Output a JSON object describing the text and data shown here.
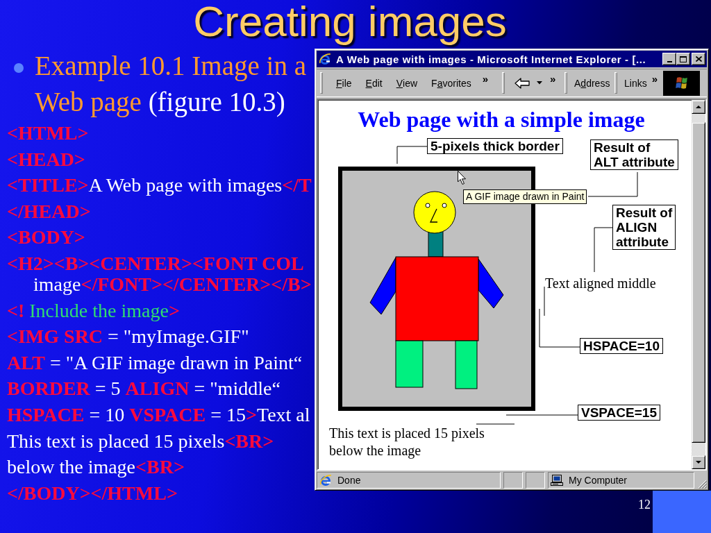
{
  "slide": {
    "title": "Creating images",
    "bullet": {
      "lines": [
        [
          {
            "kind": "accent",
            "text": "Example 10.1 Image in a"
          }
        ],
        [
          {
            "kind": "accent",
            "text": "Web page"
          },
          {
            "kind": "plain",
            "text": " (figure 10.3)"
          }
        ]
      ]
    },
    "code_lines": [
      {
        "segments": [
          {
            "kind": "tag",
            "text": "<HTML>"
          }
        ]
      },
      {
        "segments": [
          {
            "kind": "tag",
            "text": "<HEAD>"
          }
        ]
      },
      {
        "segments": [
          {
            "kind": "tag",
            "text": "<TITLE>"
          },
          {
            "kind": "text",
            "text": "A Web page with images"
          },
          {
            "kind": "tag",
            "text": "</T"
          }
        ]
      },
      {
        "segments": [
          {
            "kind": "tag",
            "text": "</HEAD>"
          }
        ]
      },
      {
        "segments": [
          {
            "kind": "tag",
            "text": "<BODY>"
          }
        ]
      },
      {
        "segments": [
          {
            "kind": "tag",
            "text": "<H2><B><CENTER><FONT COL"
          }
        ],
        "wrapped_segments": [
          {
            "kind": "text",
            "text": "image"
          },
          {
            "kind": "tag",
            "text": "</FONT></CENTER></B>"
          }
        ]
      },
      {
        "segments": [
          {
            "kind": "tag",
            "text": "<!"
          },
          {
            "kind": "comment",
            "text": " Include the image"
          },
          {
            "kind": "tag",
            "text": ">"
          }
        ]
      },
      {
        "segments": [
          {
            "kind": "tag",
            "text": "<IMG SRC"
          },
          {
            "kind": "text",
            "text": " = \"myImage.GIF\""
          }
        ]
      },
      {
        "segments": [
          {
            "kind": "tag",
            "text": "ALT"
          },
          {
            "kind": "text",
            "text": " = \"A GIF image drawn in Paint“"
          }
        ]
      },
      {
        "segments": [
          {
            "kind": "tag",
            "text": "BORDER"
          },
          {
            "kind": "text",
            "text": " = 5 "
          },
          {
            "kind": "tag",
            "text": "ALIGN"
          },
          {
            "kind": "text",
            "text": " = \"middle“"
          }
        ]
      },
      {
        "segments": [
          {
            "kind": "tag",
            "text": "HSPACE"
          },
          {
            "kind": "text",
            "text": " = 10 "
          },
          {
            "kind": "tag",
            "text": "VSPACE"
          },
          {
            "kind": "text",
            "text": " = 15"
          },
          {
            "kind": "tag",
            "text": ">"
          },
          {
            "kind": "text",
            "text": "Text al"
          }
        ]
      },
      {
        "segments": [
          {
            "kind": "text",
            "text": "This text is placed 15 pixels"
          },
          {
            "kind": "tag",
            "text": "<BR>"
          }
        ]
      },
      {
        "segments": [
          {
            "kind": "text",
            "text": "below the image"
          },
          {
            "kind": "tag",
            "text": "<BR>"
          }
        ]
      },
      {
        "segments": [
          {
            "kind": "tag",
            "text": "</BODY></HTML>"
          }
        ]
      }
    ],
    "slide_number": "12"
  },
  "browser": {
    "title": "A Web page with images - Microsoft Internet Explorer - [...",
    "menu": [
      {
        "key": "F",
        "after": "ile"
      },
      {
        "key": "E",
        "after": "dit"
      },
      {
        "key": "V",
        "after": "iew"
      },
      {
        "before": "F",
        "key": "a",
        "after": "vorites"
      }
    ],
    "toolbar": {
      "menu_chevron": "»",
      "nav_chevron": "»",
      "address": {
        "before": "A",
        "key": "d",
        "after": "dress"
      },
      "links": "Links",
      "links_chevron": "»"
    },
    "page": {
      "heading": "Web page with a simple image",
      "side_text": "Text aligned middle",
      "below_text": [
        "This text is placed 15 pixels",
        "below the image"
      ]
    },
    "callouts": [
      {
        "lines": [
          "5-pixels thick border"
        ]
      },
      {
        "lines": [
          "Result of",
          "ALT attribute"
        ]
      },
      {
        "lines": [
          "Result of",
          "ALIGN",
          "attribute"
        ]
      },
      {
        "lines": [
          "HSPACE=10"
        ]
      },
      {
        "lines": [
          "VSPACE=15"
        ]
      }
    ],
    "tooltip": "A GIF image drawn in Paint",
    "status": {
      "text": "Done",
      "zone": "My Computer"
    }
  }
}
